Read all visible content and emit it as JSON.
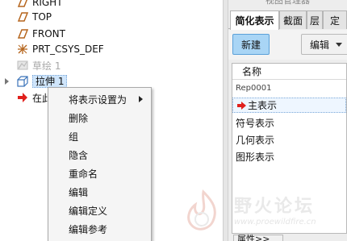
{
  "model_tree": {
    "items": [
      {
        "label": "RIGHT",
        "icon": "datum-plane-icon"
      },
      {
        "label": "TOP",
        "icon": "datum-plane-icon"
      },
      {
        "label": "FRONT",
        "icon": "datum-plane-icon"
      },
      {
        "label": "PRT_CSYS_DEF",
        "icon": "coordinate-system-icon"
      },
      {
        "label": "草绘 1",
        "icon": "sketch-icon",
        "dimmed": true
      },
      {
        "label": "拉伸 1",
        "icon": "extrude-icon",
        "selected": true
      },
      {
        "label": "在此",
        "icon": "insert-here-arrow-icon"
      }
    ]
  },
  "context_menu": {
    "items": [
      {
        "label": "将表示设置为",
        "submenu": true
      },
      {
        "label": "删除"
      },
      {
        "label": "组"
      },
      {
        "label": "隐含"
      },
      {
        "label": "重命名"
      },
      {
        "label": "编辑"
      },
      {
        "label": "编辑定义"
      },
      {
        "label": "编辑参考"
      }
    ]
  },
  "view_manager": {
    "title": "视图管理器",
    "tabs": [
      "简化表示",
      "截面",
      "层",
      "定"
    ],
    "active_tab": "简化表示",
    "new_button": "新建",
    "edit_button": "编辑",
    "list_header": "名称",
    "rows": [
      "Rep0001",
      "主表示",
      "符号表示",
      "几何表示",
      "图形表示"
    ],
    "active_row": "主表示",
    "properties_button": "属性>>"
  },
  "watermark": {
    "title": "野火论坛",
    "url": "www.proewildfire.cn"
  },
  "colors": {
    "selection": "#cfe5fb",
    "new_button": "#a9d5f5",
    "arrow_red": "#e0201c",
    "datum_brown": "#b5651d"
  }
}
